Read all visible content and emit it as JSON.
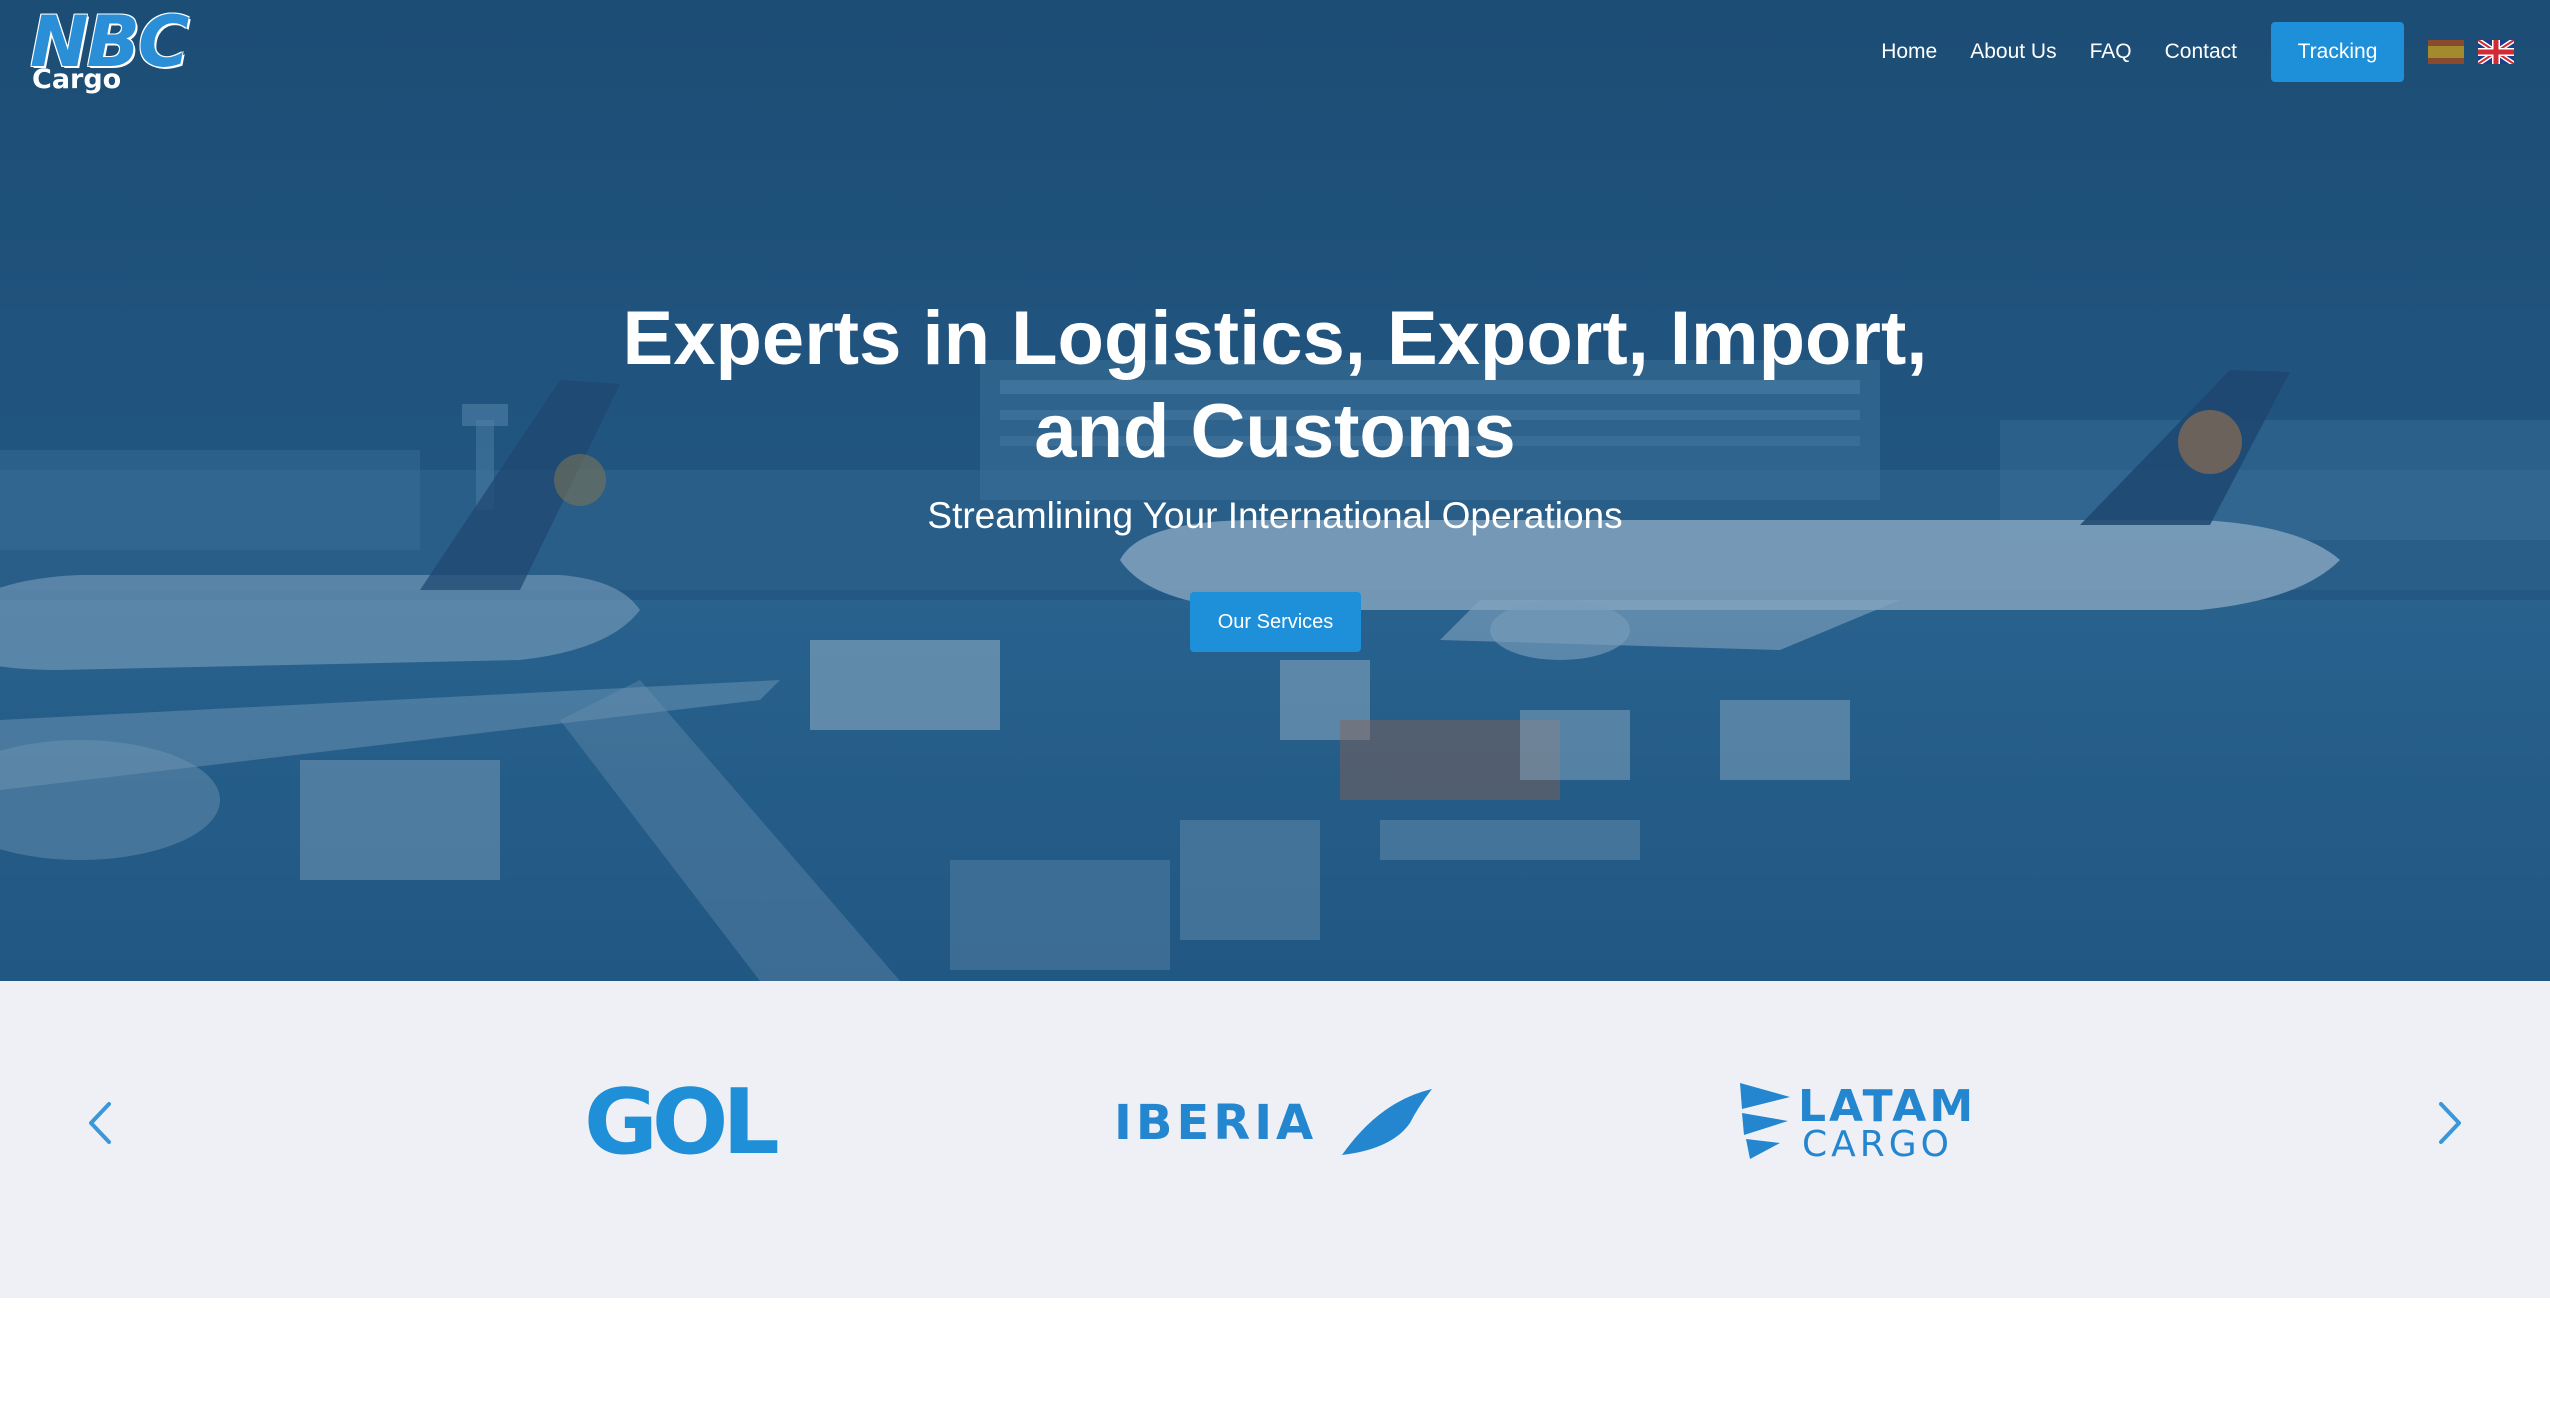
{
  "brand": {
    "logo_main": "NBC",
    "logo_sub": "Cargo"
  },
  "nav": {
    "links": [
      "Home",
      "About Us",
      "FAQ",
      "Contact"
    ],
    "tracking_label": "Tracking",
    "languages": [
      "spanish-flag-icon",
      "uk-flag-icon"
    ]
  },
  "hero": {
    "title_line1": "Experts in Logistics, Export, Import,",
    "title_line2": "and Customs",
    "subtitle": "Streamlining Your International Operations",
    "cta_label": "Our Services",
    "background": "airport-apron-photo"
  },
  "partners": {
    "logos": [
      {
        "name": "GOL",
        "text": "GOL"
      },
      {
        "name": "IBERIA",
        "text": "IBERIA"
      },
      {
        "name": "LATAM CARGO",
        "line1": "LATAM",
        "line2": "CARGO"
      }
    ],
    "prev_icon": "chevron-left-icon",
    "next_icon": "chevron-right-icon"
  },
  "colors": {
    "accent": "#1e8fd9",
    "hero_overlay": "#1f4f74",
    "partners_bg": "#eff0f5",
    "partner_logo": "#2386cf"
  }
}
